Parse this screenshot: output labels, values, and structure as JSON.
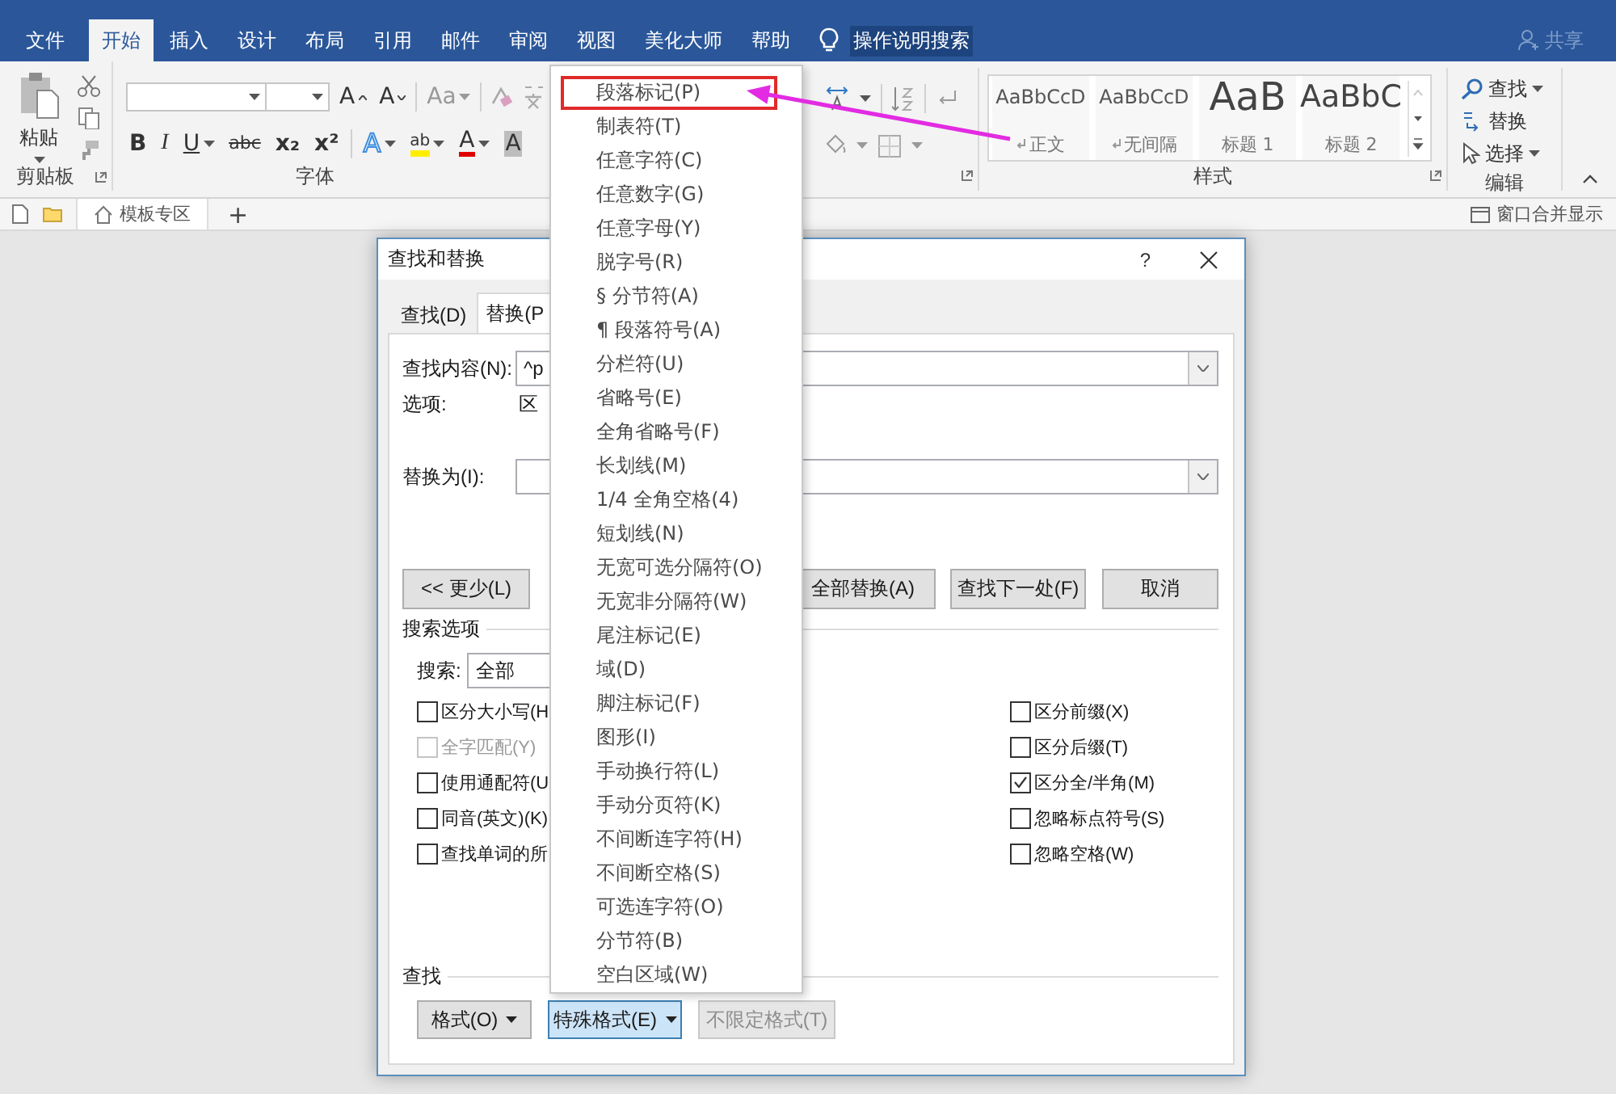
{
  "app": {
    "tabs": [
      {
        "label": "文件",
        "selected": false
      },
      {
        "label": "开始",
        "selected": true
      },
      {
        "label": "插入",
        "selected": false
      },
      {
        "label": "设计",
        "selected": false
      },
      {
        "label": "布局",
        "selected": false
      },
      {
        "label": "引用",
        "selected": false
      },
      {
        "label": "邮件",
        "selected": false
      },
      {
        "label": "审阅",
        "selected": false
      },
      {
        "label": "视图",
        "selected": false
      },
      {
        "label": "美化大师",
        "selected": false
      },
      {
        "label": "帮助",
        "selected": false
      }
    ],
    "tell_me": "操作说明搜索",
    "share": "共享"
  },
  "ribbon": {
    "clipboard": {
      "paste": "粘贴",
      "label": "剪贴板"
    },
    "font": {
      "label": "字体",
      "row_1": [
        {
          "kind": "grow",
          "text": "A"
        },
        {
          "kind": "shrink",
          "text": "A"
        },
        {
          "kind": "case",
          "text": "Aa"
        }
      ],
      "row_2": [
        {
          "kind": "bold",
          "text": "B"
        },
        {
          "kind": "italic",
          "text": "I"
        },
        {
          "kind": "underline",
          "text": "U"
        },
        {
          "kind": "strike",
          "text": "abc"
        },
        {
          "kind": "subscript",
          "text": "x₂"
        },
        {
          "kind": "superscript",
          "text": "x²"
        },
        {
          "kind": "effects",
          "text": "A"
        },
        {
          "kind": "highlight",
          "text": "ab"
        },
        {
          "kind": "color",
          "text": "A"
        },
        {
          "kind": "shading",
          "text": "A"
        }
      ]
    },
    "styles": {
      "label": "样式",
      "items": [
        {
          "sample": "AaBbCcD",
          "name": "正文",
          "kind": "normal"
        },
        {
          "sample": "AaBbCcD",
          "name": "无间隔",
          "kind": "normal"
        },
        {
          "sample": "AaB",
          "name": "标题 1",
          "kind": "heading_1"
        },
        {
          "sample": "AaBbC",
          "name": "标题 2",
          "kind": "heading_2"
        }
      ]
    },
    "editing": {
      "label": "编辑",
      "items": [
        {
          "kind": "find",
          "label": "查找",
          "dropdown": true
        },
        {
          "kind": "replace",
          "label": "替换",
          "dropdown": false
        },
        {
          "kind": "select",
          "label": "选择",
          "dropdown": true
        }
      ]
    }
  },
  "doc_bar": {
    "tab": "模板专区",
    "add": "+",
    "merge": "窗口合并显示"
  },
  "dialog": {
    "title": "查找和替换",
    "help": "?",
    "tabs": [
      {
        "label": "查找(D)",
        "selected": false
      },
      {
        "label": "替换(P",
        "selected": true
      }
    ],
    "find_what": {
      "label": "查找内容(N):",
      "value": "^p"
    },
    "options": {
      "label": "选项:",
      "value": "区"
    },
    "replace_with": {
      "label": "替换为(I):"
    },
    "actions": [
      {
        "label": "<< 更少(L)"
      },
      {
        "label": "全部替换(A)"
      },
      {
        "label": "查找下一处(F)"
      },
      {
        "label": "取消"
      }
    ],
    "search_options": {
      "title": "搜索选项",
      "search_label": "搜索:",
      "search_value": "全部",
      "left": [
        {
          "label": "区分大小写(H",
          "checked": false,
          "disabled": false
        },
        {
          "label": "全字匹配(Y)",
          "checked": false,
          "disabled": true
        },
        {
          "label": "使用通配符(U",
          "checked": false,
          "disabled": false
        },
        {
          "label": "同音(英文)(K)",
          "checked": false,
          "disabled": false
        },
        {
          "label": "查找单词的所",
          "checked": false,
          "disabled": false
        }
      ],
      "right": [
        {
          "label": "区分前缀(X)",
          "checked": false,
          "disabled": false
        },
        {
          "label": "区分后缀(T)",
          "checked": false,
          "disabled": false
        },
        {
          "label": "区分全/半角(M)",
          "checked": true,
          "disabled": false
        },
        {
          "label": "忽略标点符号(S)",
          "checked": false,
          "disabled": false
        },
        {
          "label": "忽略空格(W)",
          "checked": false,
          "disabled": false
        }
      ]
    },
    "find_format": {
      "title": "查找",
      "buttons": [
        {
          "label": "格式(O)",
          "dropdown": true,
          "pressed": false,
          "disabled": false
        },
        {
          "label": "特殊格式(E)",
          "dropdown": true,
          "pressed": true,
          "disabled": false
        },
        {
          "label": "不限定格式(T)",
          "dropdown": false,
          "pressed": false,
          "disabled": true
        }
      ]
    }
  },
  "special_menu": {
    "items": [
      {
        "label": "段落标记(P)",
        "selected": true
      },
      {
        "label": "制表符(T)",
        "selected": false
      },
      {
        "label": "任意字符(C)",
        "selected": false
      },
      {
        "label": "任意数字(G)",
        "selected": false
      },
      {
        "label": "任意字母(Y)",
        "selected": false
      },
      {
        "label": "脱字号(R)",
        "selected": false
      },
      {
        "label": "§ 分节符(A)",
        "selected": false
      },
      {
        "label": "¶ 段落符号(A)",
        "selected": false
      },
      {
        "label": "分栏符(U)",
        "selected": false
      },
      {
        "label": "省略号(E)",
        "selected": false
      },
      {
        "label": "全角省略号(F)",
        "selected": false
      },
      {
        "label": "长划线(M)",
        "selected": false
      },
      {
        "label": "1/4 全角空格(4)",
        "selected": false
      },
      {
        "label": "短划线(N)",
        "selected": false
      },
      {
        "label": "无宽可选分隔符(O)",
        "selected": false
      },
      {
        "label": "无宽非分隔符(W)",
        "selected": false
      },
      {
        "label": "尾注标记(E)",
        "selected": false
      },
      {
        "label": "域(D)",
        "selected": false
      },
      {
        "label": "脚注标记(F)",
        "selected": false
      },
      {
        "label": "图形(I)",
        "selected": false
      },
      {
        "label": "手动换行符(L)",
        "selected": false
      },
      {
        "label": "手动分页符(K)",
        "selected": false
      },
      {
        "label": "不间断连字符(H)",
        "selected": false
      },
      {
        "label": "不间断空格(S)",
        "selected": false
      },
      {
        "label": "可选连字符(O)",
        "selected": false
      },
      {
        "label": "分节符(B)",
        "selected": false
      },
      {
        "label": "空白区域(W)",
        "selected": false
      }
    ]
  }
}
